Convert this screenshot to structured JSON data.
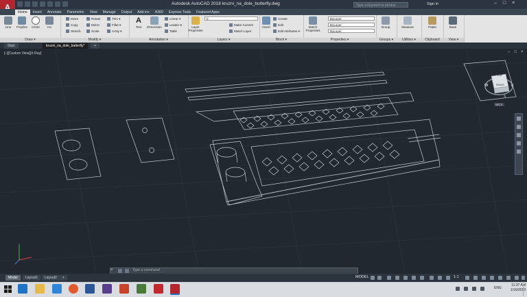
{
  "window": {
    "title": "Autodesk AutoCAD 2018    kruzni_na_dole_butterfly.dwg",
    "search_placeholder": "Type a keyword or phrase",
    "signin_label": "Sign In",
    "controls": [
      "–",
      "□",
      "×"
    ],
    "logo_text": "A"
  },
  "ribbon_tabs": [
    "Home",
    "Insert",
    "Annotate",
    "Parametric",
    "View",
    "Manage",
    "Output",
    "Add-ins",
    "A360",
    "Express Tools",
    "Featured Apps"
  ],
  "ribbon": {
    "draw": {
      "title": "Draw ▾",
      "buttons": [
        "Line",
        "Polyline",
        "Circle",
        "Arc"
      ]
    },
    "modify": {
      "title": "Modify ▾",
      "buttons": [
        "Move",
        "Rotate",
        "Trim ▾",
        "Copy",
        "Mirror",
        "Fillet ▾",
        "Stretch",
        "Scale",
        "Array ▾"
      ]
    },
    "annotation": {
      "title": "Annotation ▾",
      "buttons": [
        "Text",
        "Dimension",
        "Linear ▾",
        "Leader ▾",
        "Table"
      ]
    },
    "layers": {
      "title": "Layers ▾",
      "big": "Layer Properties",
      "buttons": [
        "Make Current",
        "Match Layer"
      ],
      "layer_value": "0"
    },
    "block": {
      "title": "Block ▾",
      "big": "Insert",
      "buttons": [
        "Create",
        "Edit",
        "Edit Attributes ▾"
      ]
    },
    "properties": {
      "title": "Properties ▾",
      "big": "Match Properties",
      "values": [
        "ByLayer",
        "ByLayer",
        "ByLayer"
      ]
    },
    "groups": {
      "title": "Groups ▾",
      "big": "Group"
    },
    "utilities": {
      "title": "Utilities ▾",
      "big": "Measure"
    },
    "clipboard": {
      "title": "Clipboard",
      "big": "Paste"
    },
    "view": {
      "title": "View ▾",
      "big": "Base"
    }
  },
  "file_tabs": [
    "Start",
    "kruzni_na_dole_butterfly*",
    "+"
  ],
  "viewport": {
    "label": "[–][Custom View][X-Ray]",
    "close_controls": [
      "–",
      "□",
      "×"
    ],
    "viewcube": {
      "top": "TOP",
      "front": "FRONT",
      "compass": [
        "N",
        "W",
        "E",
        "S"
      ],
      "wcs": "WCS"
    }
  },
  "command_line": {
    "placeholder": "Type a command",
    "close": "×"
  },
  "layout_tabs": [
    "Model",
    "Layout1",
    "Layout2",
    "+"
  ],
  "status": {
    "model_label": "MODEL",
    "scale": "1:1"
  },
  "taskbar": {
    "time": "11:37 AM",
    "date": "1/16/2019",
    "lang": "ENG"
  },
  "colors": {
    "viewport_bg": "#212830",
    "titlebar": "#2b3440",
    "autocad_red": "#b3262d",
    "ribbon_bg": "#e4e4e4"
  }
}
